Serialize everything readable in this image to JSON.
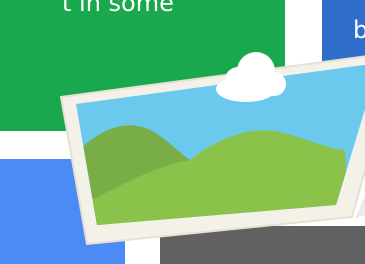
{
  "tiles": {
    "green": {
      "text": "t in some",
      "color": "#1aa84f"
    },
    "blue_right": {
      "text": "b",
      "color": "#2f6fcb"
    },
    "blue_bottom": {
      "color": "#4c8bf5"
    },
    "gray": {
      "color": "#616161"
    }
  },
  "photo": {
    "icon": "image-placeholder-icon",
    "frame_color": "#f5f2ea",
    "sky_color": "#6cc9ee",
    "hill_dark_color": "#79ae46",
    "hill_light_color": "#8bc34a",
    "cloud_color": "#ffffff"
  }
}
